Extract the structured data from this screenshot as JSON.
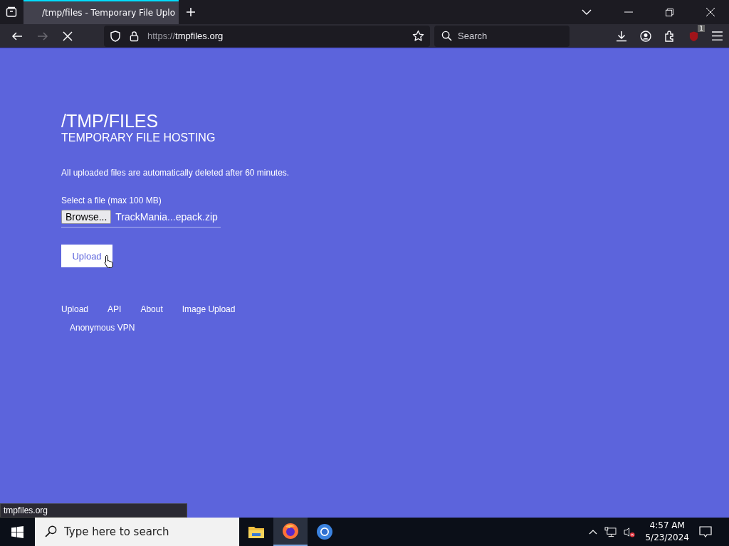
{
  "browser": {
    "tabs": [
      {
        "title": "/tmp/files - Temporary File Uplo",
        "selected": true
      }
    ],
    "address": {
      "scheme": "https://",
      "host": "tmpfiles.org"
    },
    "search": {
      "placeholder": "Search"
    },
    "extension_badge": "1"
  },
  "page": {
    "title": "/TMP/FILES",
    "subtitle": "TEMPORARY FILE HOSTING",
    "notice": "All uploaded files are automatically deleted after 60 minutes.",
    "file_label": "Select a file (max 100 MB)",
    "browse_button": "Browse...",
    "file_name": "TrackMania...epack.zip",
    "upload_button": "Upload",
    "links": [
      {
        "label": "Upload"
      },
      {
        "label": "API"
      },
      {
        "label": "About"
      },
      {
        "label": "Image Upload"
      },
      {
        "label": "Anonymous VPN"
      }
    ]
  },
  "status_bar": "tmpfiles.org",
  "taskbar": {
    "search": {
      "placeholder": "Type here to search"
    },
    "apps": [
      {
        "kind": "folder",
        "selected": false
      },
      {
        "kind": "firefox",
        "selected": true
      },
      {
        "kind": "chrome",
        "selected": false
      }
    ],
    "time": "4:57 AM",
    "date": "5/23/2024"
  }
}
